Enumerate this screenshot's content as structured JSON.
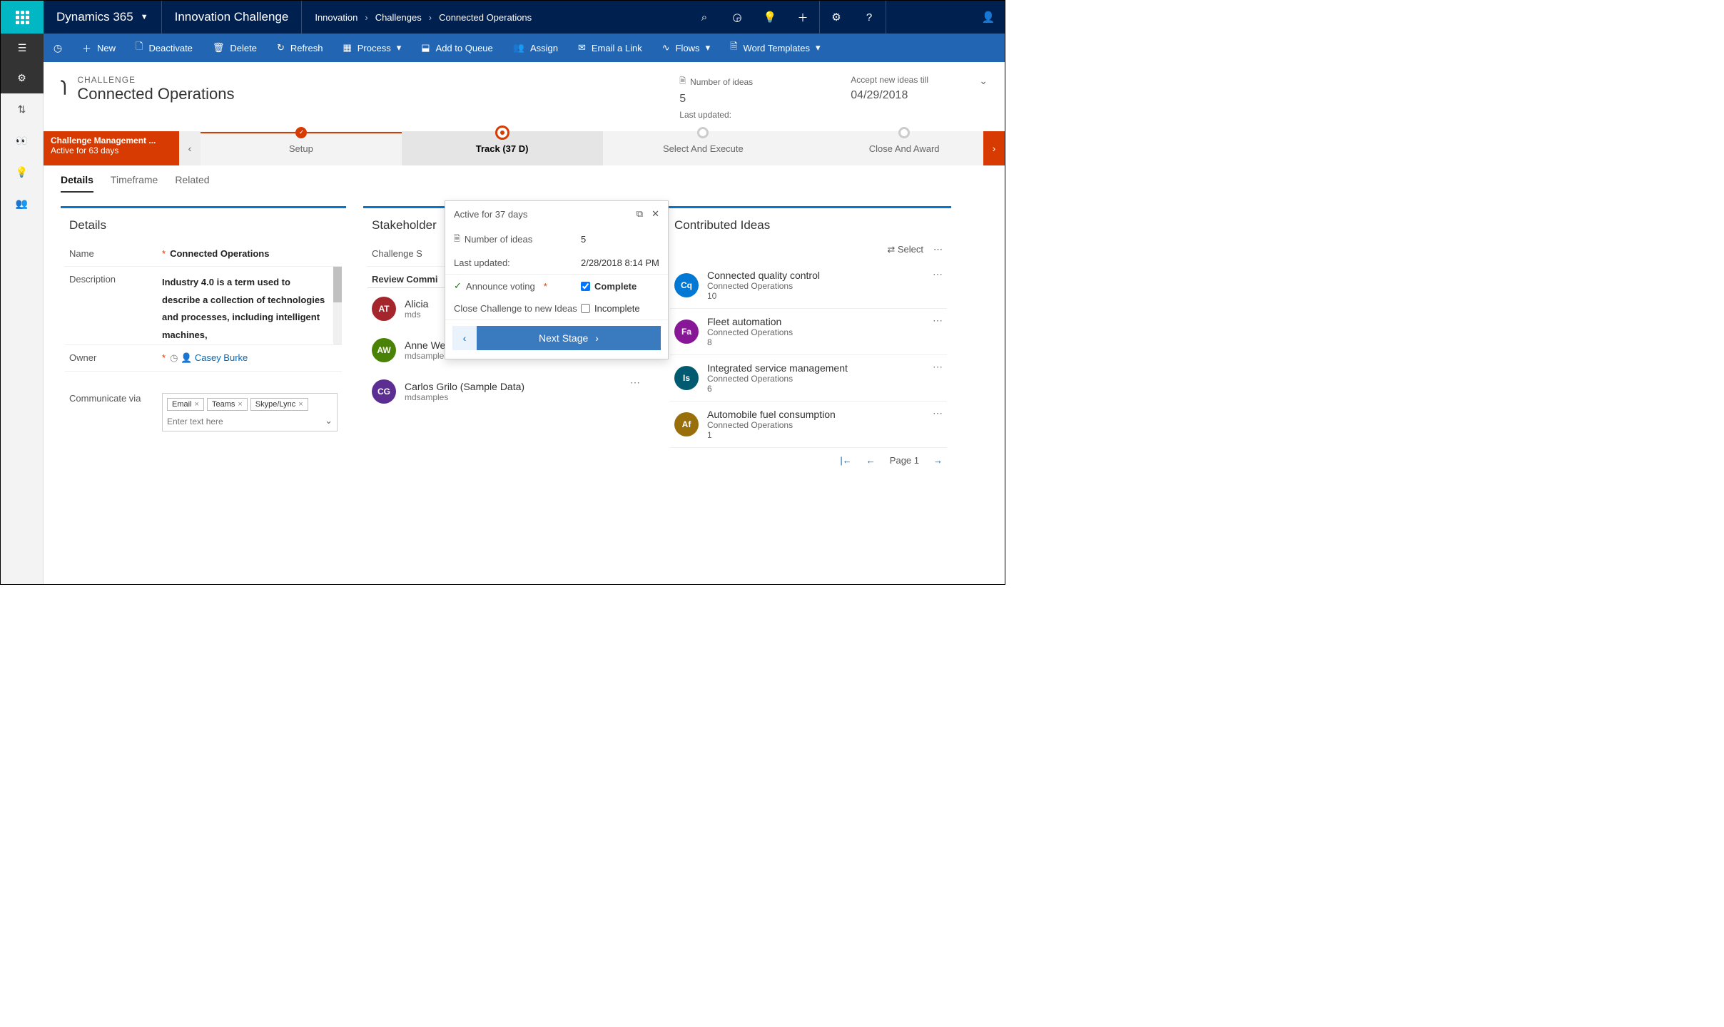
{
  "topnav": {
    "brand": "Dynamics 365",
    "app": "Innovation Challenge",
    "breadcrumb": [
      "Innovation",
      "Challenges",
      "Connected Operations"
    ]
  },
  "cmdbar": {
    "new": "New",
    "deactivate": "Deactivate",
    "delete": "Delete",
    "refresh": "Refresh",
    "process": "Process",
    "add_to_queue": "Add to Queue",
    "assign": "Assign",
    "email_link": "Email a Link",
    "flows": "Flows",
    "word_templates": "Word Templates"
  },
  "header": {
    "type": "CHALLENGE",
    "title": "Connected Operations",
    "kpi1_label": "Number of ideas",
    "kpi1_value": "5",
    "kpi2_label": "Accept new ideas till",
    "kpi2_value": "04/29/2018",
    "kpi3_label": "Last updated:"
  },
  "process": {
    "badge_title": "Challenge Management ...",
    "badge_sub": "Active for 63 days",
    "stages": [
      "Setup",
      "Track  (37 D)",
      "Select And Execute",
      "Close And Award"
    ]
  },
  "tabs": [
    "Details",
    "Timeframe",
    "Related"
  ],
  "details": {
    "card_title": "Details",
    "name_label": "Name",
    "name_value": "Connected Operations",
    "desc_label": "Description",
    "desc_value": "Industry 4.0 is a term used to describe a collection of technologies and processes, including intelligent machines,",
    "owner_label": "Owner",
    "owner_value": "Casey Burke",
    "comm_label": "Communicate via",
    "tags": [
      "Email",
      "Teams",
      "Skype/Lync"
    ],
    "tag_placeholder": "Enter text here"
  },
  "stakeholders": {
    "card_title": "Stakeholder",
    "sponsor_label": "Challenge S",
    "review_title": "Review Commi",
    "people": [
      {
        "initials": "AT",
        "name": "Alicia",
        "sub": "mds"
      },
      {
        "initials": "AW",
        "name": "Anne Weiler (Sample Data)",
        "sub": "mdsamples"
      },
      {
        "initials": "CG",
        "name": "Carlos Grilo (Sample Data)",
        "sub": "mdsamples"
      }
    ]
  },
  "ideas": {
    "card_title": "Contributed Ideas",
    "select_label": "Select",
    "items": [
      {
        "av": "Cq",
        "cls": "c-cq",
        "title": "Connected quality control",
        "sub": "Connected Operations",
        "count": "10"
      },
      {
        "av": "Fa",
        "cls": "c-fa",
        "title": "Fleet automation",
        "sub": "Connected Operations",
        "count": "8"
      },
      {
        "av": "Is",
        "cls": "c-is",
        "title": "Integrated service management",
        "sub": "Connected Operations",
        "count": "6"
      },
      {
        "av": "Af",
        "cls": "c-af",
        "title": "Automobile fuel consumption",
        "sub": "Connected Operations",
        "count": "1"
      }
    ],
    "page_label": "Page 1"
  },
  "flyout": {
    "header": "Active for 37 days",
    "num_ideas_label": "Number of ideas",
    "num_ideas_value": "5",
    "last_updated_label": "Last updated:",
    "last_updated_value": "2/28/2018 8:14 PM",
    "announce_label": "Announce voting",
    "complete": "Complete",
    "close_label": "Close Challenge to new Ideas",
    "incomplete": "Incomplete",
    "next_stage": "Next Stage"
  }
}
